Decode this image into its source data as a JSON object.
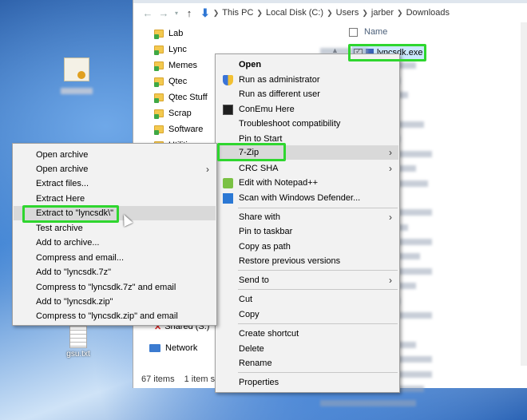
{
  "desktop": {
    "txt_icon_label": "gsu.txt"
  },
  "explorer": {
    "breadcrumb": [
      "This PC",
      "Local Disk (C:)",
      "Users",
      "jarber",
      "Downloads"
    ],
    "tree": [
      "Lab",
      "Lync",
      "Memes",
      "Qtec",
      "Qtec Stuff",
      "Scrap",
      "Software",
      "Utilities"
    ],
    "tree_bottom": [
      "Shared (S:)",
      "Network"
    ],
    "column_name": "Name",
    "selected_file": "lyncsdk.exe",
    "status_items": "67 items",
    "status_selected": "1 item se"
  },
  "context_menu": {
    "items": [
      {
        "label": "Open",
        "bold": true
      },
      {
        "label": "Run as administrator",
        "icon": "shield-icon"
      },
      {
        "label": "Run as different user"
      },
      {
        "label": "ConEmu Here",
        "icon": "conemu-icon"
      },
      {
        "label": "Troubleshoot compatibility"
      },
      {
        "label": "Pin to Start"
      },
      {
        "label": "7-Zip",
        "submenu": true,
        "highlighted": true
      },
      {
        "label": "CRC SHA",
        "submenu": true
      },
      {
        "label": "Edit with Notepad++",
        "icon": "notepadpp-icon"
      },
      {
        "label": "Scan with Windows Defender...",
        "icon": "defender-icon"
      },
      {
        "label": "Share with",
        "submenu": true
      },
      {
        "label": "Pin to taskbar"
      },
      {
        "label": "Copy as path"
      },
      {
        "label": "Restore previous versions"
      },
      {
        "label": "Send to",
        "submenu": true
      },
      {
        "label": "Cut"
      },
      {
        "label": "Copy"
      },
      {
        "label": "Create shortcut"
      },
      {
        "label": "Delete"
      },
      {
        "label": "Rename"
      },
      {
        "label": "Properties"
      }
    ]
  },
  "zip_submenu": {
    "items": [
      {
        "label": "Open archive"
      },
      {
        "label": "Open archive",
        "submenu": true
      },
      {
        "label": "Extract files..."
      },
      {
        "label": "Extract Here"
      },
      {
        "label": "Extract to \"lyncsdk\\\"",
        "highlighted": true
      },
      {
        "label": "Test archive"
      },
      {
        "label": "Add to archive..."
      },
      {
        "label": "Compress and email..."
      },
      {
        "label": "Add to \"lyncsdk.7z\""
      },
      {
        "label": "Compress to \"lyncsdk.7z\" and email"
      },
      {
        "label": "Add to \"lyncsdk.zip\""
      },
      {
        "label": "Compress to \"lyncsdk.zip\" and email"
      }
    ]
  },
  "colors": {
    "highlight_outline": "#2fd62f",
    "menu_bg": "#f2f2f2",
    "menu_hover": "#d9d9d9",
    "selection_bg": "#cce8ff"
  }
}
